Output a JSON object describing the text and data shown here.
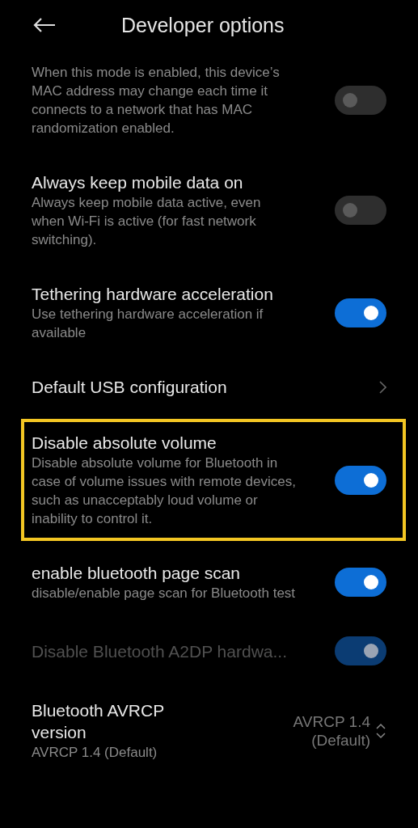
{
  "header": {
    "title": "Developer options"
  },
  "items": [
    {
      "kind": "toggle",
      "description": "When this mode is enabled, this device’s MAC address may change each time it connects to a network that has MAC randomization enabled.",
      "on": false,
      "disabled": false,
      "highlighted": false
    },
    {
      "kind": "toggle",
      "title": "Always keep mobile data on",
      "description": "Always keep mobile data active, even when Wi-Fi is active (for fast network switching).",
      "on": false,
      "disabled": false,
      "highlighted": false
    },
    {
      "kind": "toggle",
      "title": "Tethering hardware acceleration",
      "description": "Use tethering hardware acceleration if available",
      "on": true,
      "disabled": false,
      "highlighted": false
    },
    {
      "kind": "link",
      "title": "Default USB configuration",
      "disabled": false,
      "highlighted": false
    },
    {
      "kind": "toggle",
      "title": "Disable absolute volume",
      "description": "Disable absolute volume for Bluetooth in case of volume issues with remote devices, such as unacceptably loud volume or inability to control it.",
      "on": true,
      "disabled": false,
      "highlighted": true
    },
    {
      "kind": "toggle",
      "title": "enable bluetooth page scan",
      "description": "disable/enable page scan for Bluetooth test",
      "on": true,
      "disabled": false,
      "highlighted": false
    },
    {
      "kind": "toggle",
      "title": "Disable Bluetooth A2DP hardwa...",
      "on": true,
      "disabled": true,
      "highlighted": false
    },
    {
      "kind": "dropdown",
      "title": "Bluetooth AVRCP version",
      "description": "AVRCP 1.4 (Default)",
      "value": "AVRCP 1.4 (Default)",
      "disabled": false,
      "highlighted": false
    }
  ]
}
